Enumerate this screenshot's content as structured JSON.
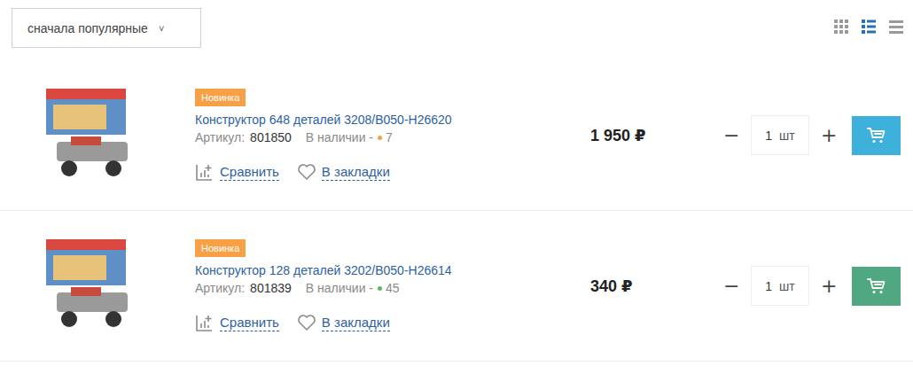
{
  "sort": {
    "label": "сначала популярные",
    "icon": "˅"
  },
  "views": [
    {
      "kind": "grid",
      "selected": false
    },
    {
      "kind": "list",
      "selected": true
    },
    {
      "kind": "compact",
      "selected": false
    }
  ],
  "products": [
    {
      "badge": "Новинка",
      "title": "Конструктор 648 деталей 3208/B050-H26620",
      "sku_label": "Артикул:",
      "sku": "801850",
      "stock_label": "В наличии -",
      "stock_count": "7",
      "color": "#f5a04a",
      "compare": "Сравнить",
      "bookmark": "В закладки",
      "price": "1 950 ₽",
      "minus": "−",
      "qty": "1",
      "unit": "шт",
      "plus": "+",
      "cart_highlighted": false
    },
    {
      "badge": "Новинка",
      "title": "Конструктор 128 деталей 3202/B050-H26614",
      "sku_label": "Артикул:",
      "sku": "801839",
      "stock_label": "В наличии -",
      "stock_count": "45",
      "color": "#5cb85c",
      "compare": "Сравнить",
      "bookmark": "В закладки",
      "price": "340 ₽",
      "minus": "−",
      "qty": "1",
      "unit": "шт",
      "plus": "+",
      "cart_highlighted": true
    }
  ]
}
